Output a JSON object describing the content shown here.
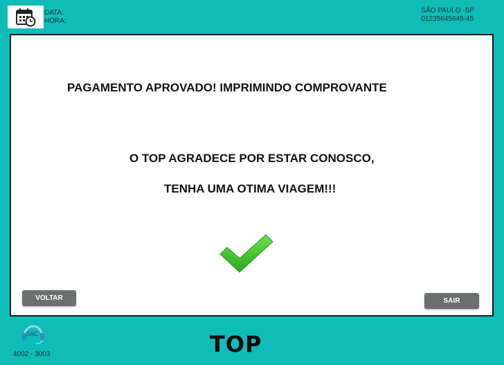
{
  "header": {
    "date_label": "DATA:",
    "time_label": "HORA:",
    "location": "SÃO PAULO -SP",
    "terminal_id": "01235645645-45",
    "calendar_icon": "calendar-clock-icon"
  },
  "main": {
    "approved_message": "PAGAMENTO APROVADO! IMPRIMINDO COMPROVANTE",
    "thanks_message": "O TOP AGRADECE POR ESTAR CONOSCO,",
    "trip_message": "TENHA UMA OTIMA VIAGEM!!!",
    "success_icon": "checkmark-icon",
    "back_button": "VOLTAR",
    "exit_button": "SAIR"
  },
  "footer": {
    "sac_label": "SAC",
    "sac_phone": "4002 - 3003",
    "brand": "TOP"
  },
  "colors": {
    "background": "#0fbcb7",
    "panel": "#ffffff",
    "button": "#6b6f6d",
    "check": "#3fc42c"
  }
}
